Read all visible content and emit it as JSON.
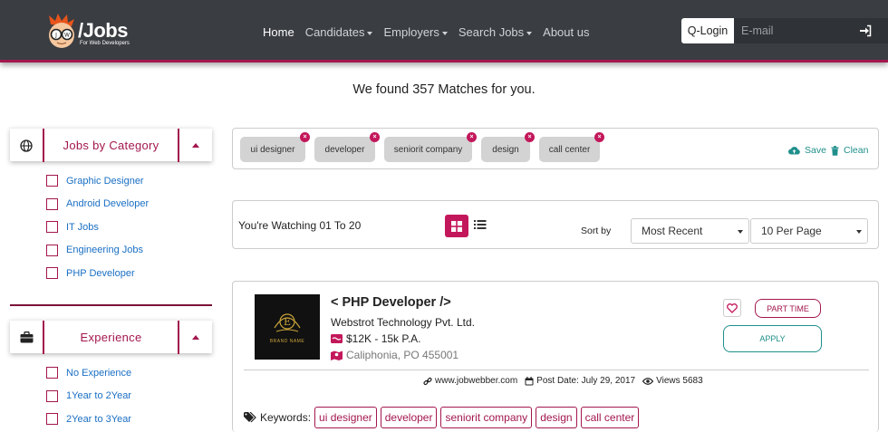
{
  "header": {
    "logo_text": "/Jobs",
    "logo_sub": "For Web Developers",
    "nav": [
      {
        "label": "Home",
        "active": true,
        "dropdown": false
      },
      {
        "label": "Candidates",
        "active": false,
        "dropdown": true
      },
      {
        "label": "Employers",
        "active": false,
        "dropdown": true
      },
      {
        "label": "Search Jobs",
        "active": false,
        "dropdown": true
      },
      {
        "label": "About us",
        "active": false,
        "dropdown": false
      }
    ],
    "qlogin_label": "Q-Login",
    "email_placeholder": "E-mail",
    "accent": "#a3174e"
  },
  "results": {
    "found_text": "We found 357 Matches for you."
  },
  "sidebar": {
    "category": {
      "title": "Jobs by Category",
      "items": [
        "Graphic Designer",
        "Android Developer",
        "IT Jobs",
        "Engineering Jobs",
        "PHP Developer"
      ]
    },
    "experience": {
      "title": "Experience",
      "items": [
        "No Experience",
        "1Year to 2Year",
        "2Year to 3Year"
      ]
    }
  },
  "filters": {
    "tags": [
      "ui designer",
      "developer",
      "seniorit company",
      "design",
      "call center"
    ],
    "remove_symbol": "×",
    "save_label": "Save",
    "clean_label": "Clean"
  },
  "sortbar": {
    "watching_text": "You're Watching 01 To 20",
    "sort_label": "Sort by",
    "sort_value": "Most Recent",
    "per_page_value": "10 Per Page"
  },
  "job": {
    "brand_letter": "E",
    "brand_name": "BRAND NAME",
    "title": "< PHP Developer />",
    "company": "Webstrot Technology Pvt. Ltd.",
    "salary": "$12K - 15k P.A.",
    "location": "Caliphonia, PO 455001",
    "type_badge": "PART TIME",
    "apply_label": "APPLY",
    "website": "www.jobwebber.com",
    "post_date": "Post Date: July 29, 2017",
    "views": "Views 5683",
    "keywords_label": "Keywords:",
    "keywords": [
      "ui designer",
      "developer",
      "seniorit company",
      "design",
      "call center"
    ]
  }
}
